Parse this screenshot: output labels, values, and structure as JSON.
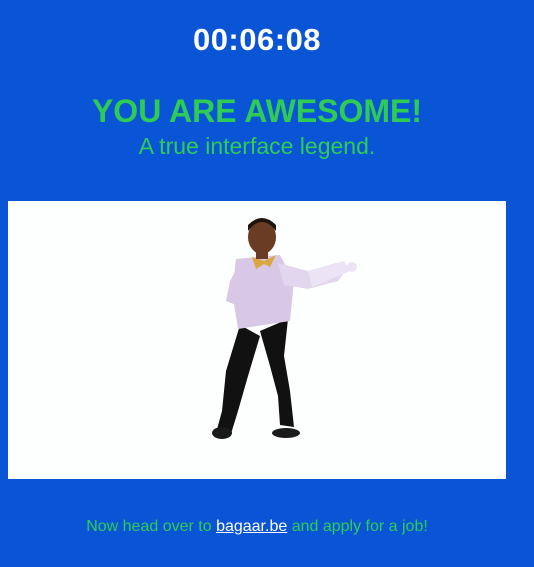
{
  "timer": "00:06:08",
  "headline": "YOU ARE AWESOME!",
  "subline": "A true interface legend.",
  "image": {
    "icon": "dancing-man-gif"
  },
  "footer": {
    "prefix": "Now head over to ",
    "link_text": "bagaar.be",
    "suffix": " and apply for a job!"
  },
  "colors": {
    "background": "#0a55d6",
    "accent": "#2ecc55",
    "text": "#ffffff"
  }
}
